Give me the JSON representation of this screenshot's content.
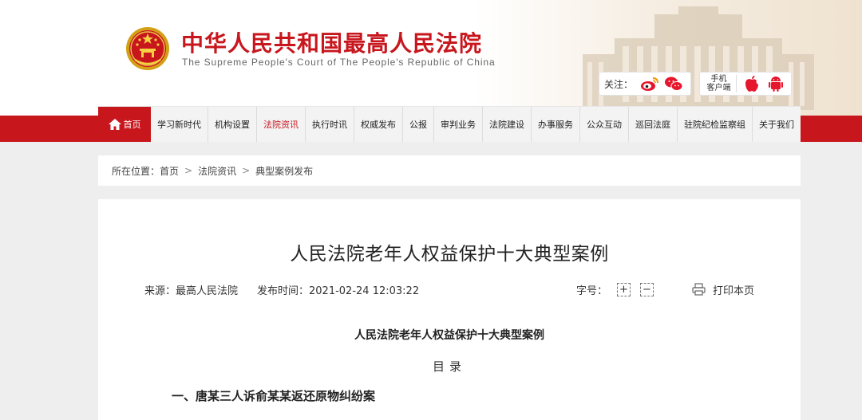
{
  "header": {
    "site_title": "中华人民共和国最高人民法院",
    "site_subtitle": "The Supreme People's Court of The People's Republic of China",
    "follow_label": "关注：",
    "client_label_line1": "手机",
    "client_label_line2": "客户端",
    "icons": [
      "emblem-icon",
      "weibo-icon",
      "wechat-icon",
      "apple-icon",
      "android-icon"
    ]
  },
  "nav": {
    "home": "首页",
    "items": [
      "学习新时代",
      "机构设置",
      "法院资讯",
      "执行时讯",
      "权威发布",
      "公报",
      "审判业务",
      "法院建设",
      "办事服务",
      "公众互动",
      "巡回法庭",
      "驻院纪检监察组",
      "关于我们"
    ],
    "active_index": 2
  },
  "breadcrumb": {
    "prefix": "所在位置：",
    "items": [
      "首页",
      "法院资讯",
      "典型案例发布"
    ],
    "separator": ">"
  },
  "article": {
    "title": "人民法院老年人权益保护十大典型案例",
    "source": "来源：最高人民法院",
    "publish_time": "发布时间：2021-02-24 12:03:22",
    "font_size_label": "字号：",
    "font_plus": "+",
    "font_minus": "−",
    "print_label": "打印本页",
    "subheading": "人民法院老年人权益保护十大典型案例",
    "toc_heading": "目录",
    "case_1": "一、唐某三人诉俞某某返还原物纠纷案"
  },
  "colors": {
    "brand_red": "#c8161d",
    "page_bg": "#eeeeee",
    "nav_bg": "#f3f3f3"
  }
}
